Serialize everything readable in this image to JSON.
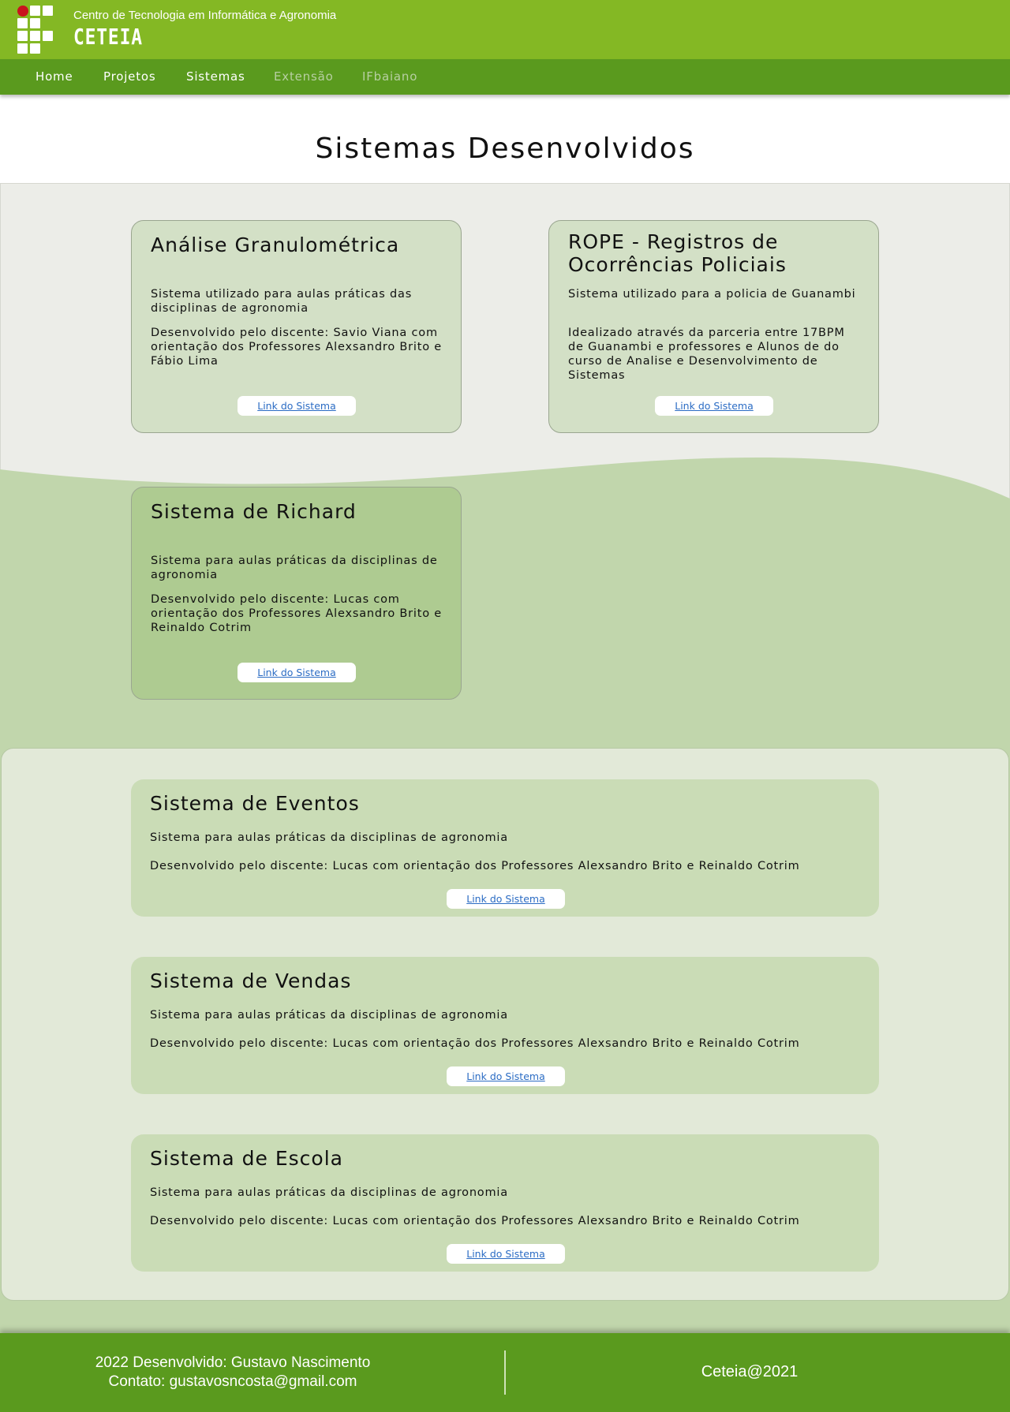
{
  "header": {
    "subtitle": "Centro de Tecnologia em Informática e Agronomia",
    "title": "CETEIA"
  },
  "nav": {
    "items": [
      {
        "label": "Home"
      },
      {
        "label": "Projetos"
      },
      {
        "label": "Sistemas"
      },
      {
        "label": "Extensão"
      },
      {
        "label": "IFbaiano"
      }
    ]
  },
  "page": {
    "title": "Sistemas Desenvolvidos"
  },
  "cards": [
    {
      "title": "Análise Granulométrica",
      "text1": "Sistema utilizado para aulas práticas das disciplinas de agronomia",
      "text2": "Desenvolvido pelo discente: Savio Viana com orientação dos Professores Alexsandro Brito e Fábio Lima",
      "link": "Link do Sistema"
    },
    {
      "title": "ROPE - Registros de Ocorrências Policiais",
      "text1": "Sistema utilizado para a policia de Guanambi",
      "text2": "Idealizado através da parceria entre 17BPM de Guanambi e professores e Alunos de do curso de Analise e Desenvolvimento de Sistemas",
      "link": "Link do Sistema"
    },
    {
      "title": "Sistema de Richard",
      "text1": "Sistema para aulas práticas da disciplinas de agronomia",
      "text2": "Desenvolvido pelo discente: Lucas com orientação dos Professores Alexsandro Brito e Reinaldo Cotrim",
      "link": "Link do Sistema"
    }
  ],
  "wide_cards": [
    {
      "title": "Sistema de Eventos",
      "text1": "Sistema para aulas práticas da disciplinas de agronomia",
      "text2": "Desenvolvido pelo discente: Lucas com orientação dos Professores Alexsandro Brito e Reinaldo Cotrim",
      "link": "Link do Sistema"
    },
    {
      "title": "Sistema de Vendas",
      "text1": "Sistema para aulas práticas da disciplinas de agronomia",
      "text2": "Desenvolvido pelo discente: Lucas com orientação dos Professores Alexsandro Brito e Reinaldo Cotrim",
      "link": "Link do Sistema"
    },
    {
      "title": "Sistema de Escola",
      "text1": "Sistema para aulas práticas da disciplinas de agronomia",
      "text2": "Desenvolvido pelo discente: Lucas com orientação dos Professores Alexsandro Brito e Reinaldo Cotrim",
      "link": "Link do Sistema"
    }
  ],
  "footer": {
    "line1": "2022 Desenvolvido: Gustavo Nascimento",
    "line2": "Contato: gustavosncosta@gmail.com",
    "right": "Ceteia@2021"
  },
  "colors": {
    "header_green": "#84b824",
    "nav_green": "#5a9a1e",
    "wave_green": "#c1d6ac",
    "card_green": "#cadcb6",
    "link_blue": "#2b6cc4"
  }
}
